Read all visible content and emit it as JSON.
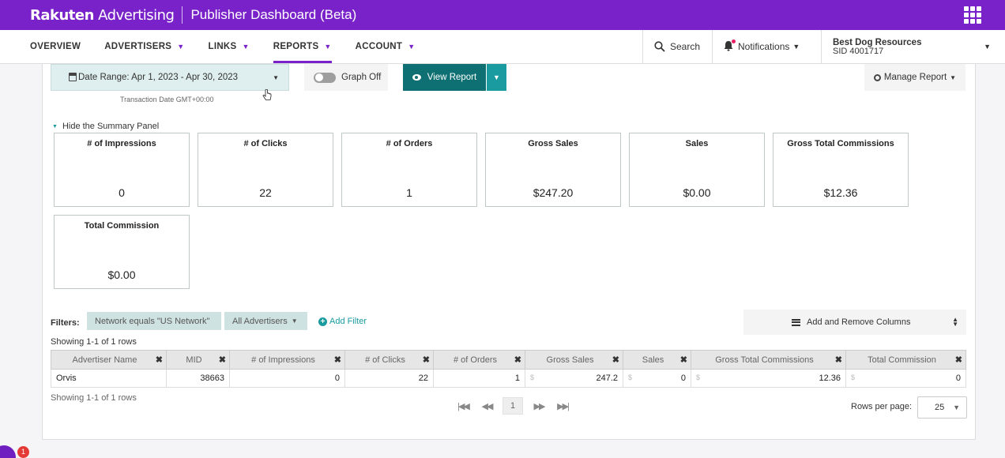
{
  "brand": {
    "logo_bold": "Rakuten",
    "logo_light": " Advertising",
    "app_title": "Publisher Dashboard (Beta)"
  },
  "nav": {
    "tabs": [
      {
        "label": "OVERVIEW",
        "has_caret": false
      },
      {
        "label": "ADVERTISERS",
        "has_caret": true
      },
      {
        "label": "LINKS",
        "has_caret": true
      },
      {
        "label": "REPORTS",
        "has_caret": true,
        "active": true
      },
      {
        "label": "ACCOUNT",
        "has_caret": true
      }
    ],
    "search_label": "Search",
    "notifications_label": "Notifications",
    "account_name": "Best Dog Resources",
    "account_sid": "SID 4001717"
  },
  "report": {
    "date_range_label": "Date Range: Apr 1, 2023 - Apr 30, 2023",
    "date_caption": "Transaction Date GMT+00:00",
    "graph_toggle_label": "Graph Off",
    "view_report_label": "View Report",
    "manage_report_label": "Manage Report"
  },
  "summary": {
    "toggle_label": "Hide the Summary Panel",
    "cards": [
      {
        "label": "# of Impressions",
        "value": "0"
      },
      {
        "label": "# of Clicks",
        "value": "22"
      },
      {
        "label": "# of Orders",
        "value": "1"
      },
      {
        "label": "Gross Sales",
        "value": "$247.20"
      },
      {
        "label": "Sales",
        "value": "$0.00"
      },
      {
        "label": "Gross Total Commissions",
        "value": "$12.36"
      },
      {
        "label": "Total Commission",
        "value": "$0.00"
      }
    ]
  },
  "filters": {
    "label": "Filters:",
    "chips": [
      "Network equals \"US Network\"",
      "All Advertisers"
    ],
    "add_filter_label": "Add Filter",
    "add_columns_label": "Add and Remove Columns"
  },
  "table": {
    "rows_caption_top": "Showing 1-1 of 1 rows",
    "rows_caption_bottom": "Showing 1-1 of 1 rows",
    "columns": [
      "Advertiser Name",
      "MID",
      "# of Impressions",
      "# of Clicks",
      "# of Orders",
      "Gross Sales",
      "Sales",
      "Gross Total Commissions",
      "Total Commission"
    ],
    "rows": [
      [
        "Orvis",
        "38663",
        "0",
        "22",
        "1",
        "247.2",
        "0",
        "12.36",
        "0"
      ]
    ]
  },
  "pagination": {
    "current_page": "1",
    "rows_per_page_label": "Rows per page:",
    "rows_per_page_value": "25"
  },
  "help": {
    "badge_count": "1"
  },
  "colors": {
    "brand_purple": "#7a22c9",
    "teal_dark": "#0f7073",
    "teal": "#1a9ba0"
  }
}
